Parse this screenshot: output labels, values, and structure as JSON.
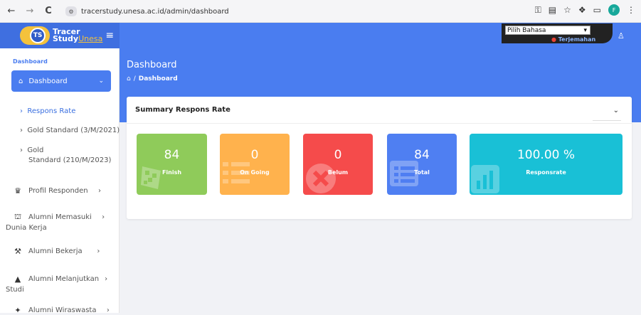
{
  "browser": {
    "back": "←",
    "forward": "→",
    "reload": "C",
    "url": "tracerstudy.unesa.ac.id/admin/dashboard",
    "profile_initial": "F"
  },
  "header": {
    "logo_ts": "TS",
    "logo_line1": "Tracer",
    "logo_line2": "Study",
    "logo_brand": "Unesa",
    "language_select": "Pilih Bahasa",
    "translate_label": "Terjemahan"
  },
  "banner": {
    "title": "Dashboard",
    "breadcrumb_current": "Dashboard"
  },
  "sidebar": {
    "section_label": "Dashboard",
    "active_item": "Dashboard",
    "subitems": [
      "Respons Rate",
      "Gold Standard (3/M/2021)",
      "Gold",
      "Standard (210/M/2023)"
    ],
    "items": [
      {
        "label": "Profil Responden",
        "icon": "user-tie-icon"
      },
      {
        "label": "Alumni Memasuki",
        "label2": "Dunia Kerja",
        "icon": "school-icon"
      },
      {
        "label": "Alumni Bekerja",
        "icon": "worker-icon"
      },
      {
        "label": "Alumni Melanjutkan",
        "label2": "Studi",
        "icon": "graduation-cap-icon"
      },
      {
        "label": "Alumni Wiraswasta",
        "icon": "entrepreneur-icon"
      }
    ]
  },
  "card": {
    "title": "Summary Respons Rate"
  },
  "stats": [
    {
      "value": "84",
      "label": "Finish",
      "color": "#8fcb5a",
      "icon": "checkered-flag-icon"
    },
    {
      "value": "0",
      "label": "On Going",
      "color": "#ffb24d",
      "icon": "tasks-icon"
    },
    {
      "value": "0",
      "label": "Belum",
      "color": "#f54b4b",
      "icon": "times-circle-icon"
    },
    {
      "value": "84",
      "label": "Total",
      "color": "#4f7ff2",
      "icon": "list-icon"
    },
    {
      "value": "100.00 %",
      "label": "Responsrate",
      "color": "#19c0d6",
      "icon": "chart-icon"
    }
  ]
}
